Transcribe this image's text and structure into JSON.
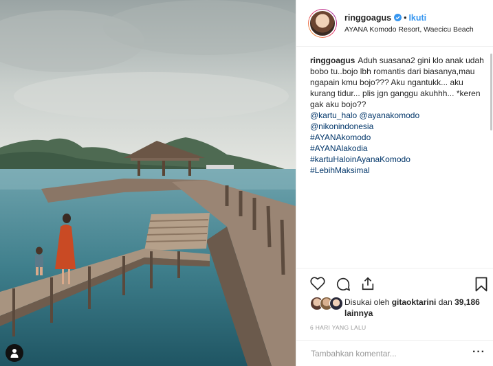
{
  "post": {
    "photo_alt": "Woman in orange dress and child on wooden jetty at Komodo",
    "username": "ringgoagus",
    "verified": true,
    "follow_label": "Ikuti",
    "location": "AYANA Komodo Resort, Waecicu Beach",
    "caption": {
      "user": "ringgoagus",
      "text": "Aduh suasana2 gini klo anak udah bobo tu..bojo lbh romantis dari biasanya,mau ngapain kmu bojo??? Aku ngantukk... aku kurang tidur... plis jgn ganggu akuhhh... *keren gak aku bojo??",
      "links": [
        "@kartu_halo @ayanakomodo",
        "@nikonindonesia",
        "#AYANAkomodo",
        "#AYANAlakodia",
        "#kartuHaloinAyanaKomodo",
        "#LebihMaksimal"
      ]
    },
    "likes": {
      "prefix": "Disukai oleh",
      "liker": "gitaoktarini",
      "connector": "dan",
      "count_text": "39,186 lainnya"
    },
    "time_ago": "6 HARI YANG LALU",
    "comment_placeholder": "Tambahkan komentar...",
    "more_label": "···"
  },
  "icons": {
    "like": "heart-icon",
    "comment": "comment-icon",
    "share": "share-icon",
    "save": "bookmark-icon",
    "verified": "verified-badge-icon",
    "user_tag": "user-tag-icon"
  },
  "colors": {
    "link": "#003569",
    "follow": "#3897f0",
    "verified": "#3897f0",
    "muted": "#999999"
  }
}
